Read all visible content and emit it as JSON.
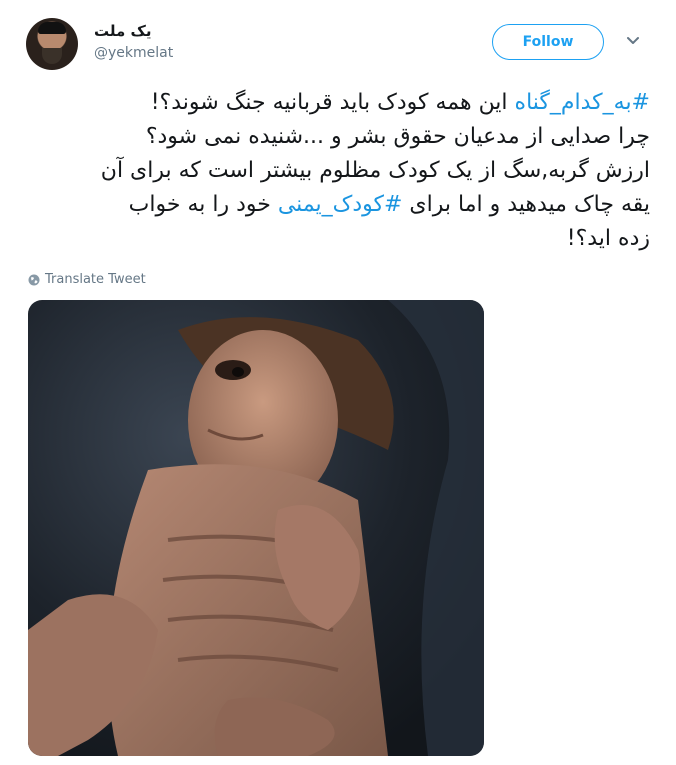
{
  "user": {
    "display_name": "یک ملت",
    "handle": "@yekmelat",
    "avatar_icon": "profile-avatar"
  },
  "follow_button": {
    "label": "Follow"
  },
  "menu": {
    "icon": "chevron-down-icon"
  },
  "tweet": {
    "lines": [
      {
        "hashtag": "#به_کدام_گناه",
        "text": " این همه کودک باید قربانیه جنگ شوند؟!"
      },
      {
        "text": "چرا صدایی از مدعیان حقوق بشر و ...شنیده نمی شود؟"
      },
      {
        "text": "ارزش گربه,سگ  از یک کودک مظلوم بیشتر است که برای آن"
      },
      {
        "text_before": "یقه چاک میدهید و اما برای ",
        "hashtag": "#کودک_یمنی",
        "text_after": " خود را به خواب"
      },
      {
        "text": "زده اید؟!"
      }
    ]
  },
  "translate": {
    "label": "Translate Tweet",
    "icon": "globe-icon"
  },
  "media": {
    "description_icon": "photo"
  },
  "colors": {
    "accent": "#1da1f2",
    "hashtag": "#1b95e0",
    "secondary_text": "#657786",
    "primary_text": "#14171a"
  }
}
